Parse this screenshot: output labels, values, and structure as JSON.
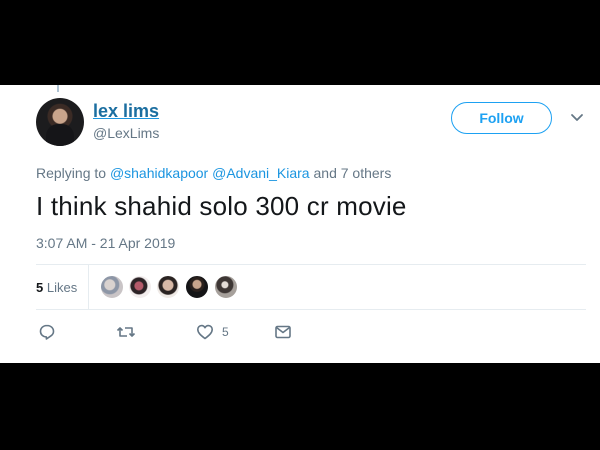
{
  "tweet": {
    "display_name": "lex lims",
    "handle": "@LexLims",
    "follow_label": "Follow",
    "replying_prefix": "Replying to",
    "mentions": [
      "@shahidkapoor",
      "@Advani_Kiara"
    ],
    "replying_suffix": "and 7 others",
    "text": "I think shahid solo 300 cr movie",
    "timestamp": "3:07 AM - 21 Apr 2019"
  },
  "likes": {
    "count": "5",
    "label": "Likes",
    "avatars": [
      "liker-avatar-1",
      "liker-avatar-2",
      "liker-avatar-3",
      "liker-avatar-4",
      "liker-avatar-5"
    ]
  },
  "actions": {
    "reply_icon": "reply-icon",
    "retweet_icon": "retweet-icon",
    "like_icon": "heart-icon",
    "like_count": "5",
    "message_icon": "direct-message-icon"
  },
  "colors": {
    "accent": "#1da1f2",
    "link": "#1b95e0",
    "muted": "#657786",
    "text": "#14171a",
    "background": "#000000"
  }
}
